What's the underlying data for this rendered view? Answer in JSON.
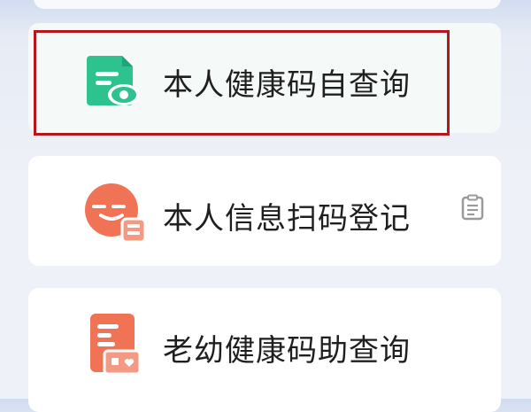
{
  "menu": {
    "items": [
      {
        "label": "本人健康码自查询",
        "icon": "health-code-document-icon"
      },
      {
        "label": "本人信息扫码登记",
        "icon": "scan-face-icon",
        "trailing_icon": "clipboard-icon"
      },
      {
        "label": "老幼健康码助查询",
        "icon": "elderly-child-document-icon"
      }
    ]
  },
  "colors": {
    "highlight_border": "#b5181c",
    "green_icon": "#2ec28f",
    "orange_icon": "#f07356"
  }
}
